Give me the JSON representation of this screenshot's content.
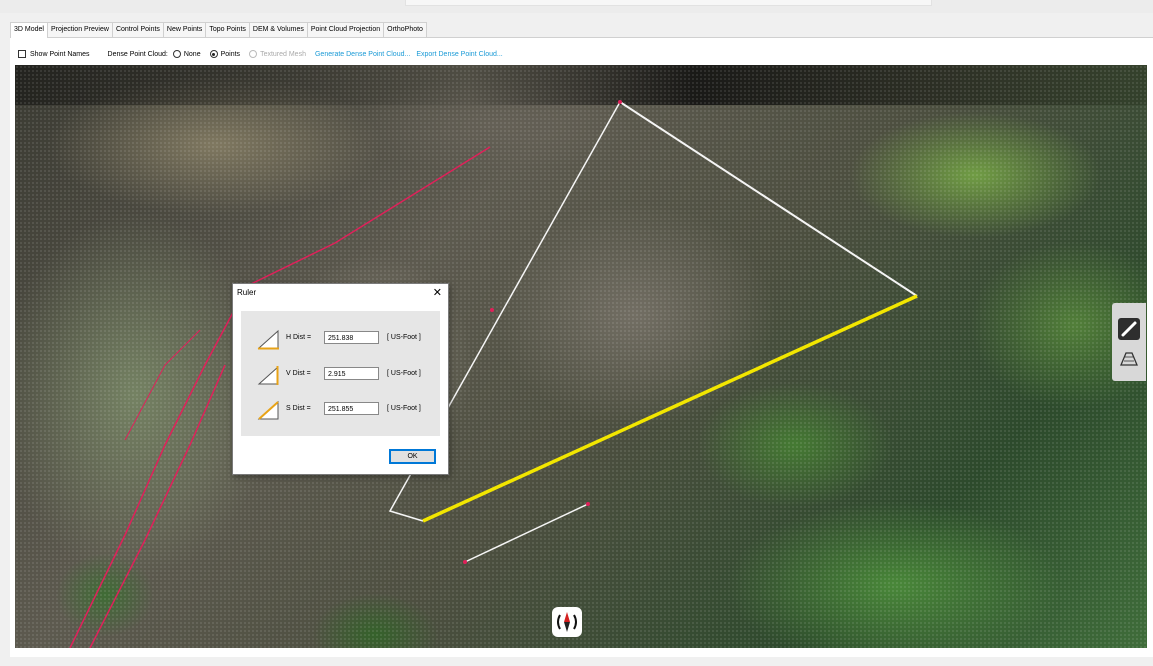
{
  "tabs": [
    {
      "label": "3D Model",
      "active": true
    },
    {
      "label": "Projection Preview",
      "active": false
    },
    {
      "label": "Control Points",
      "active": false
    },
    {
      "label": "New Points",
      "active": false
    },
    {
      "label": "Topo Points",
      "active": false
    },
    {
      "label": "DEM & Volumes",
      "active": false
    },
    {
      "label": "Point Cloud Projection",
      "active": false
    },
    {
      "label": "OrthoPhoto",
      "active": false
    }
  ],
  "toolbar": {
    "show_point_names": {
      "label": "Show Point Names",
      "checked": false
    },
    "dense_label": "Dense Point Cloud:",
    "options": [
      {
        "label": "None",
        "selected": false,
        "enabled": true
      },
      {
        "label": "Points",
        "selected": true,
        "enabled": true
      },
      {
        "label": "Textured Mesh",
        "selected": false,
        "enabled": false
      }
    ],
    "generate_link": "Generate Dense Point Cloud...",
    "export_link": "Export Dense Point Cloud..."
  },
  "ruler": {
    "title": "Ruler",
    "close": "✕",
    "rows": [
      {
        "label": "H Dist =",
        "value": "251.838",
        "unit": "[ US-Foot ]"
      },
      {
        "label": "V Dist =",
        "value": "2.915",
        "unit": "[ US-Foot ]"
      },
      {
        "label": "S Dist =",
        "value": "251.855",
        "unit": "[ US-Foot ]"
      }
    ],
    "ok": "OK"
  },
  "icons": {
    "compass": "compass-icon",
    "measure": "ruler-measure-icon",
    "volume": "volume-surface-icon"
  },
  "colors": {
    "measure_line": "#f2e600",
    "boundary_line": "#f5f5f5",
    "road_line": "#e0205a",
    "link": "#1a9ad6"
  }
}
